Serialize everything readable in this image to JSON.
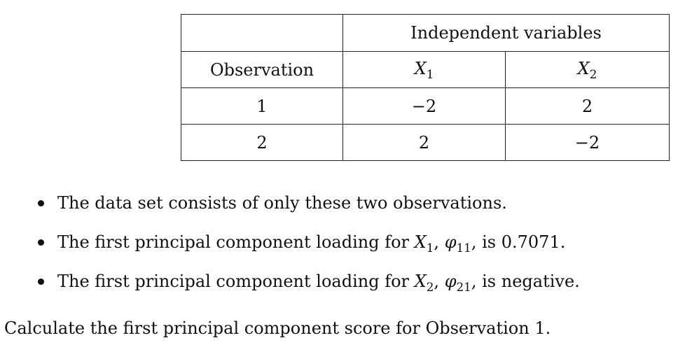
{
  "table": {
    "header_group": "Independent variables",
    "col_observation": "Observation",
    "col_x1": {
      "symbol": "X",
      "sub": "1"
    },
    "col_x2": {
      "symbol": "X",
      "sub": "2"
    },
    "rows": [
      {
        "observation": "1",
        "x1": "−2",
        "x2": "2"
      },
      {
        "observation": "2",
        "x1": "2",
        "x2": "−2"
      }
    ]
  },
  "bullets": [
    {
      "text": "The data set consists of only these two observations."
    },
    {
      "pre": "The first principal component loading for ",
      "var": "X",
      "var_sub": "1",
      "mid": ", ",
      "phi": "φ",
      "phi_sub": "11",
      "post": ", is 0.7071."
    },
    {
      "pre": "The first principal component loading for ",
      "var": "X",
      "var_sub": "2",
      "mid": ", ",
      "phi": "φ",
      "phi_sub": "21",
      "post": ", is negative."
    }
  ],
  "question": "Calculate the first principal component score for Observation 1."
}
